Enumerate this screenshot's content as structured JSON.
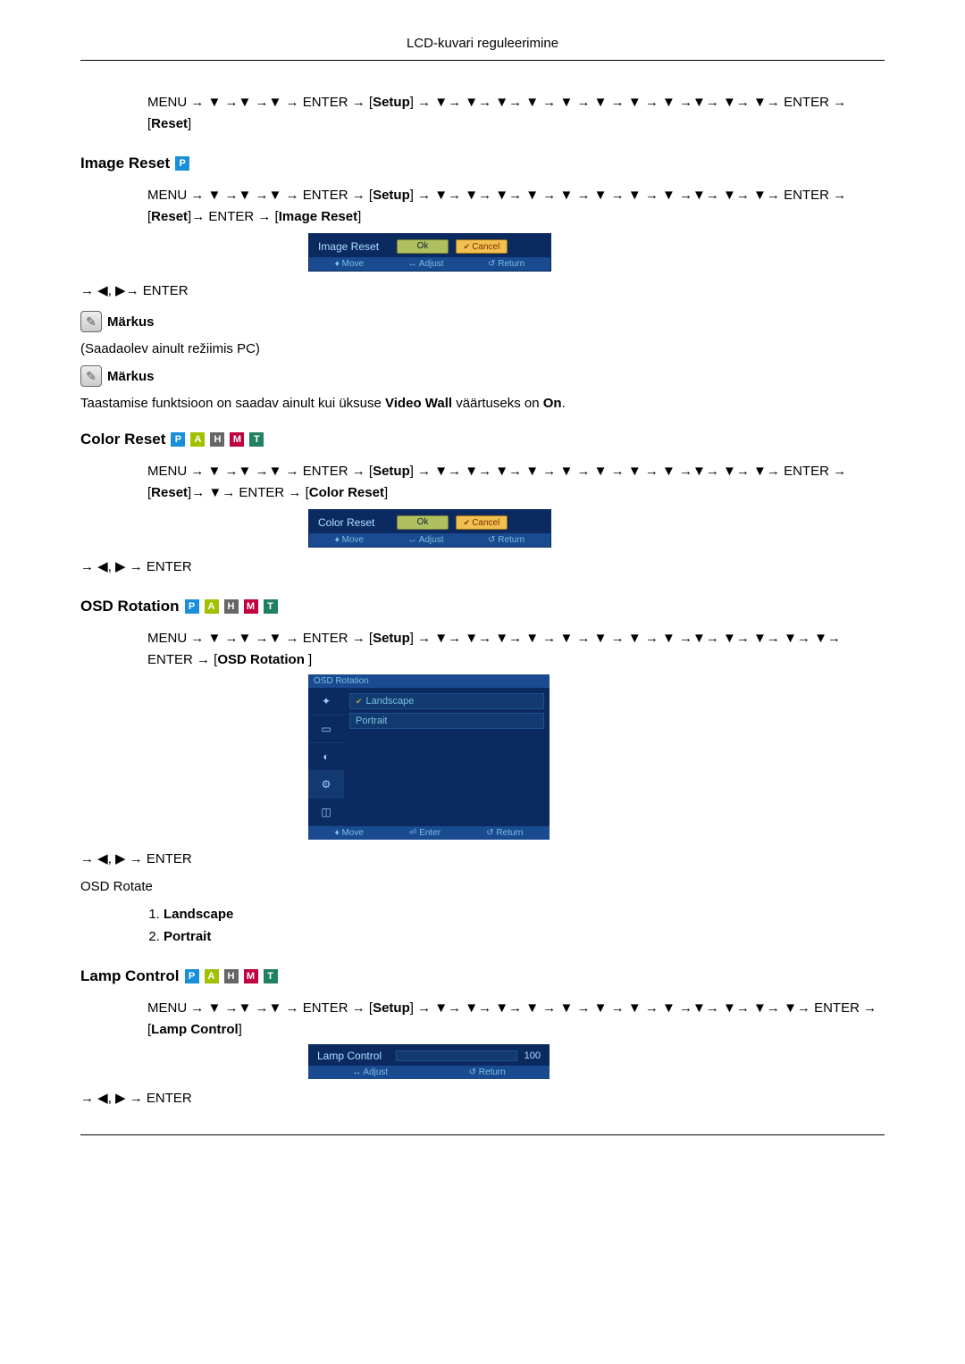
{
  "header": "LCD-kuvari reguleerimine",
  "nav": {
    "menu": "MENU",
    "enter": "ENTER",
    "setup": "Setup",
    "reset": "Reset",
    "image_reset": "Image Reset",
    "color_reset": "Color Reset",
    "osd_rotation": "OSD Rotation",
    "lamp_control": "Lamp Control"
  },
  "sections": {
    "image_reset": "Image Reset",
    "color_reset": "Color Reset",
    "osd_rotation": "OSD Rotation",
    "lamp_control": "Lamp Control"
  },
  "note_label": "Märkus",
  "notes": {
    "pc_only": "(Saadaolev ainult režiimis PC)",
    "video_wall_parts": {
      "p1": "Taastamise funktsioon on saadav ainult kui üksuse ",
      "bold1": "Video Wall",
      "p2": " väärtuseks on ",
      "bold2": "On",
      "p3": "."
    }
  },
  "osd": {
    "image_reset_title": "Image Reset",
    "color_reset_title": "Color Reset",
    "ok": "Ok",
    "cancel": "Cancel",
    "move": "Move",
    "adjust": "Adjust",
    "return": "Return",
    "enter": "Enter",
    "osd_rotation_title": "OSD Rotation",
    "landscape": "Landscape",
    "portrait": "Portrait",
    "lamp_control_title": "Lamp Control",
    "lamp_value": "100"
  },
  "osd_rotate_text": "OSD Rotate",
  "osd_rotate_opts": {
    "1": "Landscape",
    "2": "Portrait"
  },
  "badges": {
    "p": "P",
    "a": "A",
    "h": "H",
    "m": "M",
    "t": "T"
  }
}
